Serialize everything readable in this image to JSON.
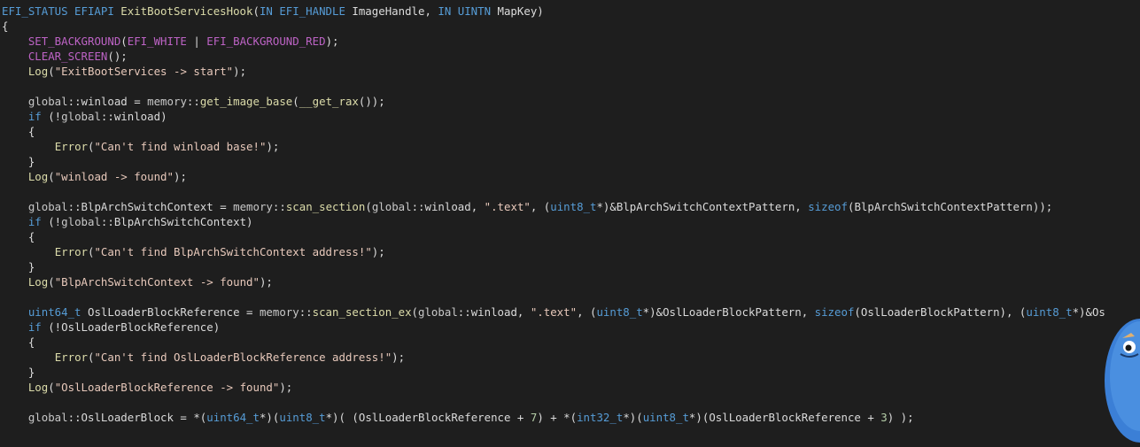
{
  "colors": {
    "background": "#1e1e1e",
    "keyword": "#569cd6",
    "macro": "#bd63c5",
    "type": "#4ec9b0",
    "string": "#e8c9bb",
    "function": "#dcdcaa",
    "number": "#b5cea8",
    "plain": "#dcdcdc"
  },
  "code_lines": [
    [
      [
        "kw",
        "EFI_STATUS EFIAPI "
      ],
      [
        "fn",
        "ExitBootServicesHook"
      ],
      [
        "plain",
        "("
      ],
      [
        "kw",
        "IN EFI_HANDLE "
      ],
      [
        "plain",
        "ImageHandle, "
      ],
      [
        "kw",
        "IN UINTN "
      ],
      [
        "plain",
        "MapKey)"
      ]
    ],
    [
      [
        "plain",
        "{"
      ]
    ],
    [
      [
        "plain",
        "    "
      ],
      [
        "macro",
        "SET_BACKGROUND"
      ],
      [
        "plain",
        "("
      ],
      [
        "macro",
        "EFI_WHITE"
      ],
      [
        "plain",
        " | "
      ],
      [
        "macro",
        "EFI_BACKGROUND_RED"
      ],
      [
        "plain",
        ");"
      ]
    ],
    [
      [
        "plain",
        "    "
      ],
      [
        "macro",
        "CLEAR_SCREEN"
      ],
      [
        "plain",
        "();"
      ]
    ],
    [
      [
        "plain",
        "    "
      ],
      [
        "fn",
        "Log"
      ],
      [
        "plain",
        "("
      ],
      [
        "str",
        "\"ExitBootServices -> start\""
      ],
      [
        "plain",
        ");"
      ]
    ],
    [
      [
        "plain",
        ""
      ]
    ],
    [
      [
        "plain",
        "    "
      ],
      [
        "ns",
        "global"
      ],
      [
        "plain",
        "::"
      ],
      [
        "var",
        "winload"
      ],
      [
        "plain",
        " = "
      ],
      [
        "ns",
        "memory"
      ],
      [
        "plain",
        "::"
      ],
      [
        "fn",
        "get_image_base"
      ],
      [
        "plain",
        "("
      ],
      [
        "fn",
        "__get_rax"
      ],
      [
        "plain",
        "());"
      ]
    ],
    [
      [
        "plain",
        "    "
      ],
      [
        "kw",
        "if"
      ],
      [
        "plain",
        " (!"
      ],
      [
        "ns",
        "global"
      ],
      [
        "plain",
        "::"
      ],
      [
        "var",
        "winload"
      ],
      [
        "plain",
        ")"
      ]
    ],
    [
      [
        "plain",
        "    {"
      ]
    ],
    [
      [
        "plain",
        "        "
      ],
      [
        "fn",
        "Error"
      ],
      [
        "plain",
        "("
      ],
      [
        "str",
        "\"Can't find winload base!\""
      ],
      [
        "plain",
        ");"
      ]
    ],
    [
      [
        "plain",
        "    }"
      ]
    ],
    [
      [
        "plain",
        "    "
      ],
      [
        "fn",
        "Log"
      ],
      [
        "plain",
        "("
      ],
      [
        "str",
        "\"winload -> found\""
      ],
      [
        "plain",
        ");"
      ]
    ],
    [
      [
        "plain",
        ""
      ]
    ],
    [
      [
        "plain",
        "    "
      ],
      [
        "ns",
        "global"
      ],
      [
        "plain",
        "::"
      ],
      [
        "var",
        "BlpArchSwitchContext"
      ],
      [
        "plain",
        " = "
      ],
      [
        "ns",
        "memory"
      ],
      [
        "plain",
        "::"
      ],
      [
        "fn",
        "scan_section"
      ],
      [
        "plain",
        "("
      ],
      [
        "ns",
        "global"
      ],
      [
        "plain",
        "::"
      ],
      [
        "var",
        "winload"
      ],
      [
        "plain",
        ", "
      ],
      [
        "str",
        "\".text\""
      ],
      [
        "plain",
        ", ("
      ],
      [
        "kw",
        "uint8_t"
      ],
      [
        "plain",
        "*)&"
      ],
      [
        "var",
        "BlpArchSwitchContextPattern"
      ],
      [
        "plain",
        ", "
      ],
      [
        "kw",
        "sizeof"
      ],
      [
        "plain",
        "("
      ],
      [
        "var",
        "BlpArchSwitchContextPattern"
      ],
      [
        "plain",
        "));"
      ]
    ],
    [
      [
        "plain",
        "    "
      ],
      [
        "kw",
        "if"
      ],
      [
        "plain",
        " (!"
      ],
      [
        "ns",
        "global"
      ],
      [
        "plain",
        "::"
      ],
      [
        "var",
        "BlpArchSwitchContext"
      ],
      [
        "plain",
        ")"
      ]
    ],
    [
      [
        "plain",
        "    {"
      ]
    ],
    [
      [
        "plain",
        "        "
      ],
      [
        "fn",
        "Error"
      ],
      [
        "plain",
        "("
      ],
      [
        "str",
        "\"Can't find BlpArchSwitchContext address!\""
      ],
      [
        "plain",
        ");"
      ]
    ],
    [
      [
        "plain",
        "    }"
      ]
    ],
    [
      [
        "plain",
        "    "
      ],
      [
        "fn",
        "Log"
      ],
      [
        "plain",
        "("
      ],
      [
        "str",
        "\"BlpArchSwitchContext -> found\""
      ],
      [
        "plain",
        ");"
      ]
    ],
    [
      [
        "plain",
        ""
      ]
    ],
    [
      [
        "plain",
        "    "
      ],
      [
        "kw",
        "uint64_t "
      ],
      [
        "var",
        "OslLoaderBlockReference"
      ],
      [
        "plain",
        " = "
      ],
      [
        "ns",
        "memory"
      ],
      [
        "plain",
        "::"
      ],
      [
        "fn",
        "scan_section_ex"
      ],
      [
        "plain",
        "("
      ],
      [
        "ns",
        "global"
      ],
      [
        "plain",
        "::"
      ],
      [
        "var",
        "winload"
      ],
      [
        "plain",
        ", "
      ],
      [
        "str",
        "\".text\""
      ],
      [
        "plain",
        ", ("
      ],
      [
        "kw",
        "uint8_t"
      ],
      [
        "plain",
        "*)&"
      ],
      [
        "var",
        "OslLoaderBlockPattern"
      ],
      [
        "plain",
        ", "
      ],
      [
        "kw",
        "sizeof"
      ],
      [
        "plain",
        "("
      ],
      [
        "var",
        "OslLoaderBlockPattern"
      ],
      [
        "plain",
        "), ("
      ],
      [
        "kw",
        "uint8_t"
      ],
      [
        "plain",
        "*)&Os"
      ]
    ],
    [
      [
        "plain",
        "    "
      ],
      [
        "kw",
        "if"
      ],
      [
        "plain",
        " (!"
      ],
      [
        "var",
        "OslLoaderBlockReference"
      ],
      [
        "plain",
        ")"
      ]
    ],
    [
      [
        "plain",
        "    {"
      ]
    ],
    [
      [
        "plain",
        "        "
      ],
      [
        "fn",
        "Error"
      ],
      [
        "plain",
        "("
      ],
      [
        "str",
        "\"Can't find OslLoaderBlockReference address!\""
      ],
      [
        "plain",
        ");"
      ]
    ],
    [
      [
        "plain",
        "    }"
      ]
    ],
    [
      [
        "plain",
        "    "
      ],
      [
        "fn",
        "Log"
      ],
      [
        "plain",
        "("
      ],
      [
        "str",
        "\"OslLoaderBlockReference -> found\""
      ],
      [
        "plain",
        ");"
      ]
    ],
    [
      [
        "plain",
        ""
      ]
    ],
    [
      [
        "plain",
        "    "
      ],
      [
        "ns",
        "global"
      ],
      [
        "plain",
        "::"
      ],
      [
        "var",
        "OslLoaderBlock"
      ],
      [
        "plain",
        " = *("
      ],
      [
        "kw",
        "uint64_t"
      ],
      [
        "plain",
        "*)("
      ],
      [
        "kw",
        "uint8_t"
      ],
      [
        "plain",
        "*)( ("
      ],
      [
        "var",
        "OslLoaderBlockReference"
      ],
      [
        "plain",
        " + "
      ],
      [
        "num",
        "7"
      ],
      [
        "plain",
        ") + *("
      ],
      [
        "kw",
        "int32_t"
      ],
      [
        "plain",
        "*)("
      ],
      [
        "kw",
        "uint8_t"
      ],
      [
        "plain",
        "*)("
      ],
      [
        "var",
        "OslLoaderBlockReference"
      ],
      [
        "plain",
        " + "
      ],
      [
        "num",
        "3"
      ],
      [
        "plain",
        ") );"
      ]
    ]
  ],
  "mascot": {
    "icon": "blue-mascot-icon"
  }
}
